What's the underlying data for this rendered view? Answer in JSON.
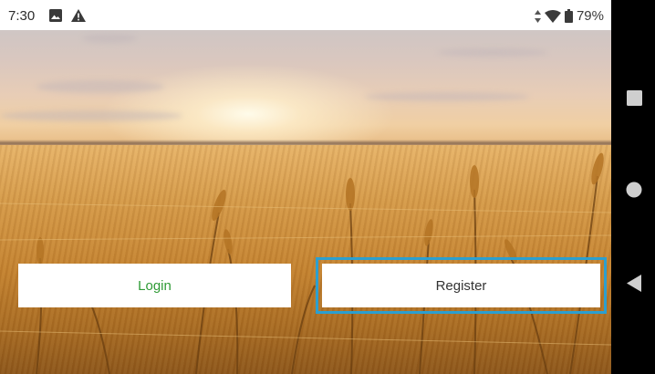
{
  "status_bar": {
    "time": "7:30",
    "left_icons": [
      "image-icon",
      "warning-icon"
    ],
    "right_icons": [
      "data-transfer-icon",
      "wifi-icon",
      "battery-icon"
    ],
    "battery_percent": "79%"
  },
  "main": {
    "background": "wheat-field-sunset",
    "login_label": "Login",
    "register_label": "Register",
    "colors": {
      "login_text": "#2e9a35",
      "register_text": "#333333",
      "focus_outline": "#2c9fcf"
    }
  },
  "nav_bar": {
    "buttons": [
      "recents-icon",
      "home-icon",
      "back-icon"
    ]
  }
}
